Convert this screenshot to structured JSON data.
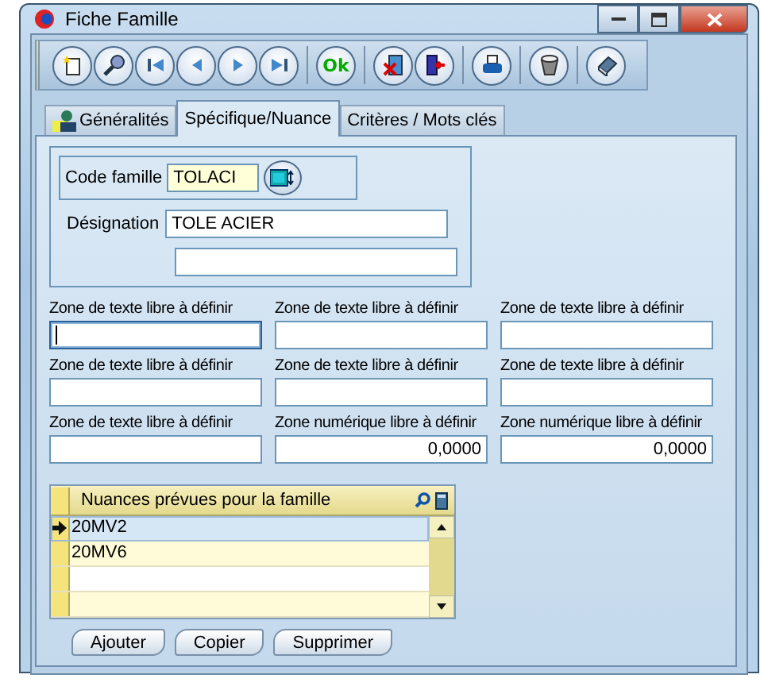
{
  "window": {
    "title": "Fiche Famille"
  },
  "toolbar": {
    "ok_label": "Ok"
  },
  "tabs": [
    {
      "label": "Généralités",
      "selected": false,
      "has_icon": true
    },
    {
      "label": "Spécifique/Nuance",
      "selected": true,
      "has_icon": false
    },
    {
      "label": "Critères / Mots clés",
      "selected": false,
      "has_icon": false
    }
  ],
  "family": {
    "code_label": "Code famille",
    "code_value": "TOLACI",
    "designation_label": "Désignation",
    "designation_value": "TOLE ACIER"
  },
  "free_fields": [
    {
      "label": "Zone de texte libre à définir",
      "kind": "text",
      "focused": true
    },
    {
      "label": "Zone de texte libre à définir",
      "kind": "text",
      "focused": false
    },
    {
      "label": "Zone de texte libre à définir",
      "kind": "text",
      "focused": false
    },
    {
      "label": "Zone de texte libre à définir",
      "kind": "text",
      "focused": false
    },
    {
      "label": "Zone de texte libre à définir",
      "kind": "text",
      "focused": false
    },
    {
      "label": "Zone de texte libre à définir",
      "kind": "text",
      "focused": false
    },
    {
      "label": "Zone de texte libre à définir",
      "kind": "text",
      "focused": false
    },
    {
      "label": "Zone numérique libre à définir",
      "kind": "number",
      "value": "0,0000",
      "focused": false
    },
    {
      "label": "Zone numérique libre à définir",
      "kind": "number",
      "value": "0,0000",
      "focused": false
    }
  ],
  "grid": {
    "header": "Nuances prévues pour la famille",
    "rows": [
      {
        "value": "20MV2",
        "selected": true
      },
      {
        "value": "20MV6",
        "selected": false
      }
    ]
  },
  "buttons": [
    "Ajouter",
    "Copier",
    "Supprimer"
  ]
}
